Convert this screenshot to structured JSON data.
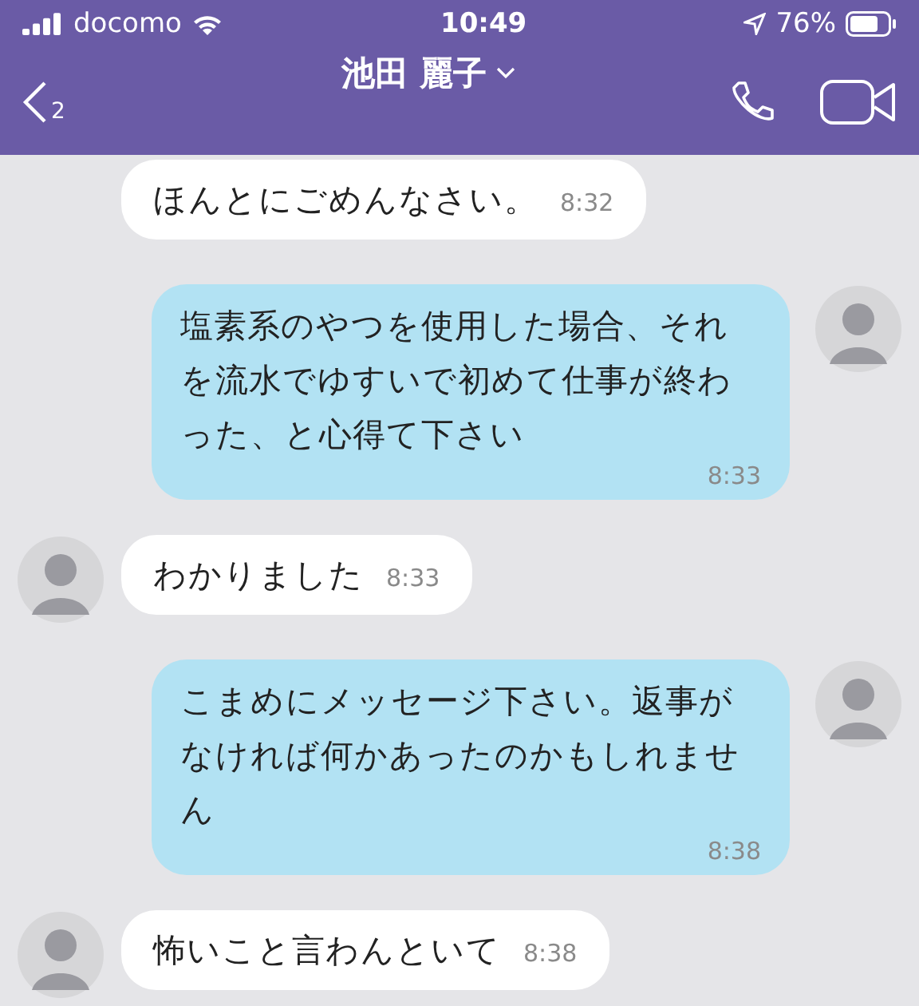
{
  "status_bar": {
    "carrier": "docomo",
    "time": "10:49",
    "battery": "76%"
  },
  "header": {
    "back_count": "2",
    "title": "池田 麗子"
  },
  "messages": [
    {
      "kind": "incoming",
      "avatar": false,
      "text": "ほんとにごめんなさい。",
      "time": "8:32"
    },
    {
      "kind": "outgoing",
      "avatar": true,
      "text": "塩素系のやつを使用した場合、それを流水でゆすいで初めて仕事が終わった、と心得て下さい",
      "time": "8:33"
    },
    {
      "kind": "incoming",
      "avatar": true,
      "text": "わかりました",
      "time": "8:33"
    },
    {
      "kind": "outgoing",
      "avatar": true,
      "text": "こまめにメッセージ下さい。返事がなければ何かあったのかもしれません",
      "time": "8:38"
    },
    {
      "kind": "incoming",
      "avatar": true,
      "text": "怖いこと言わんといて",
      "time": "8:38"
    }
  ]
}
